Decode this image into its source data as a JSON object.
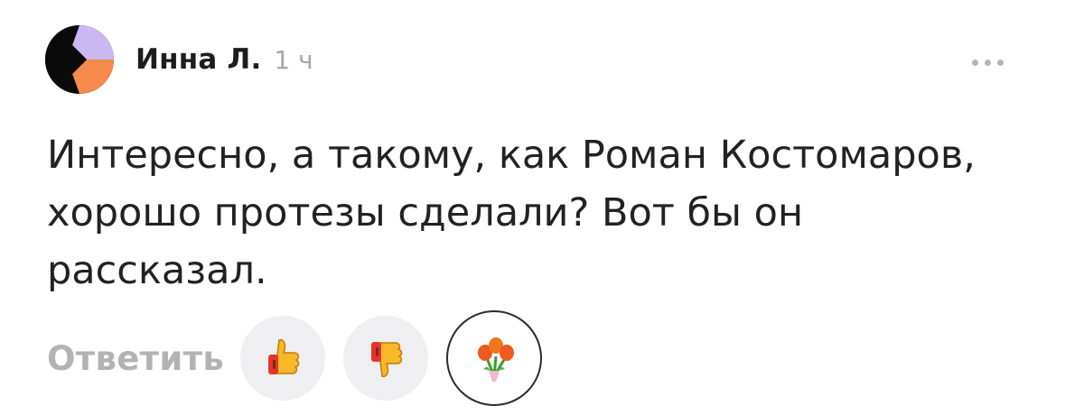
{
  "author": {
    "name": "Инна Л.",
    "time": "1 ч"
  },
  "comment": {
    "text": "Интересно, а такому, как Роман Костомаров,\nхорошо протезы сделали? Вот бы он\nрассказал."
  },
  "actions": {
    "reply_label": "Ответить",
    "reactions": [
      {
        "icon": "thumbs-up-icon"
      },
      {
        "icon": "thumbs-down-icon"
      },
      {
        "icon": "flowers-icon"
      }
    ]
  },
  "menu": {
    "icon": "more-dots-icon"
  },
  "colors": {
    "avatar_black": "#0a0a0a",
    "avatar_lavender": "#c9b8f2",
    "avatar_orange": "#f58a4a",
    "muted_text": "#b3b3b6",
    "reaction_bg": "#efeff1"
  }
}
